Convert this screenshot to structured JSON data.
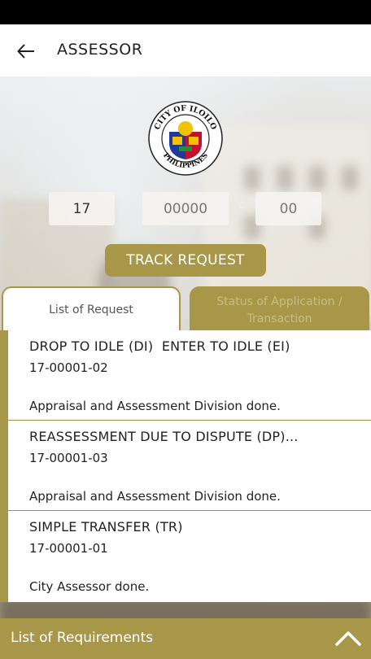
{
  "header": {
    "title": "ASSESSOR"
  },
  "logo": {
    "ring_text_top": "CITY OF ILOILO",
    "ring_text_bottom": "PHILIPPINES"
  },
  "tracker": {
    "year_value": "17",
    "number_placeholder": "00000",
    "suffix_placeholder": "00",
    "separator": "-",
    "button_label": "TRACK REQUEST"
  },
  "tabs": [
    {
      "label": "List of Request"
    },
    {
      "label_line1": "Status of Application /",
      "label_line2": "Transaction"
    }
  ],
  "requests": [
    {
      "title": "DROP TO IDLE (DI)  ENTER TO IDLE (EI)",
      "id": "17-00001-02",
      "status": "Appraisal and Assessment Division done."
    },
    {
      "title": "REASSESSMENT DUE TO DISPUTE (DP)...",
      "id": "17-00001-03",
      "status": "Appraisal and Assessment Division done."
    },
    {
      "title": "SIMPLE TRANSFER (TR)",
      "id": "17-00001-01",
      "status": "City Assessor done."
    }
  ],
  "bottom_bar": {
    "label": "List of Requirements"
  },
  "colors": {
    "accent": "#a89749",
    "header_bg": "#ffffff",
    "status_bar": "#000000"
  },
  "icons": {
    "back": "arrow-left-icon",
    "expand": "chevron-up-icon",
    "logo": "city-seal-icon"
  }
}
